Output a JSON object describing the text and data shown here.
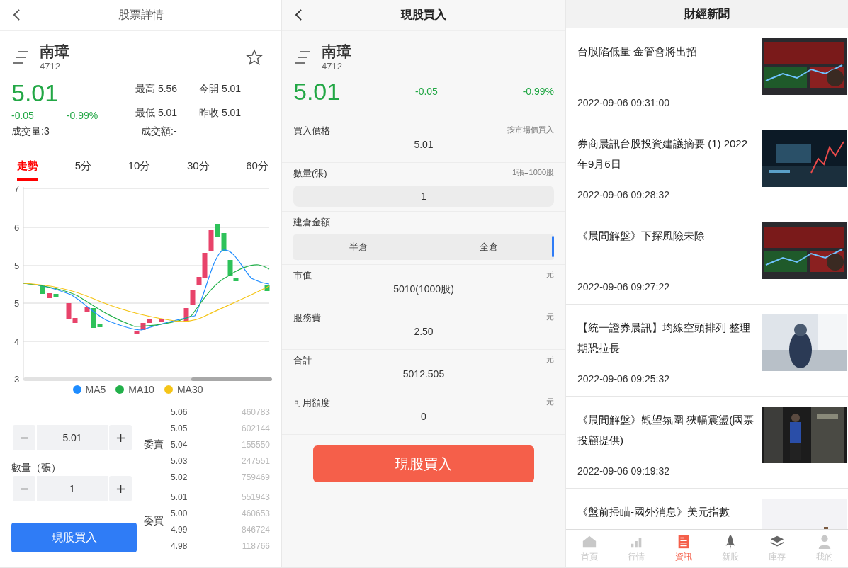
{
  "detail": {
    "header": {
      "title": "股票詳情"
    },
    "stock": {
      "name": "南璋",
      "code": "4712",
      "price": "5.01",
      "change": "-0.05",
      "change_pct": "-0.99%",
      "volume": "成交量:3",
      "amount": "成交額:-",
      "stats": [
        {
          "label": "最高",
          "value": "5.56"
        },
        {
          "label": "今開",
          "value": "5.01"
        },
        {
          "label": "最低",
          "value": "5.01"
        },
        {
          "label": "昨收",
          "value": "5.01"
        }
      ]
    },
    "tabs": [
      {
        "label": "走勢",
        "selected": true
      },
      {
        "label": "5分",
        "selected": false
      },
      {
        "label": "10分",
        "selected": false
      },
      {
        "label": "30分",
        "selected": false
      },
      {
        "label": "60分",
        "selected": false
      }
    ],
    "chart": {
      "y_labels": [
        "7",
        "6",
        "5",
        "5",
        "4",
        "3"
      ],
      "legend": [
        {
          "name": "MA5",
          "color": "#1e8cff"
        },
        {
          "name": "MA10",
          "color": "#22b04a"
        },
        {
          "name": "MA30",
          "color": "#f5c518"
        }
      ]
    },
    "order": {
      "price": "5.01",
      "quantity_label": "數量（張）",
      "quantity": "1",
      "submit": "現股買入"
    },
    "book": {
      "ask_label": "委賣",
      "bid_label": "委買",
      "asks": [
        {
          "price": "5.06",
          "volume": "460783"
        },
        {
          "price": "5.05",
          "volume": "602144"
        },
        {
          "price": "5.04",
          "volume": "155550"
        },
        {
          "price": "5.03",
          "volume": "247551"
        },
        {
          "price": "5.02",
          "volume": "759469"
        }
      ],
      "bids": [
        {
          "price": "5.01",
          "volume": "551943"
        },
        {
          "price": "5.00",
          "volume": "460653"
        },
        {
          "price": "4.99",
          "volume": "846724"
        },
        {
          "price": "4.98",
          "volume": "118766"
        }
      ]
    }
  },
  "buy": {
    "header": {
      "title": "現股買入"
    },
    "stock": {
      "name": "南璋",
      "code": "4712",
      "price": "5.01",
      "change": "-0.05",
      "change_pct": "-0.99%"
    },
    "rows": [
      {
        "kind": "text",
        "label": "買入價格",
        "hint": "按市場價買入",
        "value": "5.01"
      },
      {
        "kind": "input",
        "label": "數量(張)",
        "hint": "1張=1000股",
        "value": "1"
      },
      {
        "kind": "choice",
        "label": "建倉金額",
        "options": [
          "半倉",
          "全倉"
        ]
      },
      {
        "kind": "text",
        "label": "市值",
        "hint": "元",
        "value": "5010(1000股)"
      },
      {
        "kind": "text",
        "label": "服務費",
        "hint": "元",
        "value": "2.50"
      },
      {
        "kind": "text",
        "label": "合計",
        "hint": "元",
        "value": "5012.505"
      },
      {
        "kind": "text",
        "label": "可用額度",
        "hint": "元",
        "value": "0"
      }
    ],
    "submit": "現股買入"
  },
  "news": {
    "header": {
      "title": "財經新聞"
    },
    "items": [
      {
        "title": "台股陷低量 金管會將出招",
        "time": "2022-09-06 09:31:00"
      },
      {
        "title": "券商晨訊台股投資建議摘要 (1) 2022年9月6日",
        "time": "2022-09-06 09:28:32"
      },
      {
        "title": "《晨間解盤》下探風險未除",
        "time": "2022-09-06 09:27:22"
      },
      {
        "title": "【統一證券晨訊】均線空頭排列 整理期恐拉長",
        "time": "2022-09-06 09:25:32"
      },
      {
        "title": "《晨間解盤》觀望氛圍 狹幅震盪(國票投顧提供)",
        "time": "2022-09-06 09:19:32"
      },
      {
        "title": "《盤前掃瞄-國外消息》美元指數"
      }
    ]
  },
  "nav": [
    {
      "label": "首頁",
      "selected": false
    },
    {
      "label": "行情",
      "selected": false
    },
    {
      "label": "資訊",
      "selected": true
    },
    {
      "label": "新股",
      "selected": false
    },
    {
      "label": "庫存",
      "selected": false
    },
    {
      "label": "我的",
      "selected": false
    }
  ]
}
